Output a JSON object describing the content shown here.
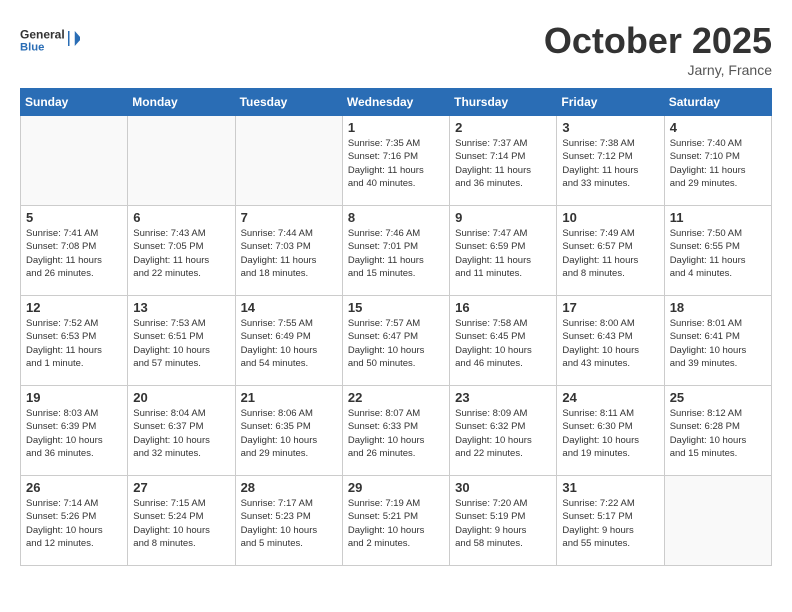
{
  "header": {
    "logo_line1": "General",
    "logo_line2": "Blue",
    "month_title": "October 2025",
    "location": "Jarny, France"
  },
  "days_of_week": [
    "Sunday",
    "Monday",
    "Tuesday",
    "Wednesday",
    "Thursday",
    "Friday",
    "Saturday"
  ],
  "weeks": [
    [
      {
        "num": "",
        "info": ""
      },
      {
        "num": "",
        "info": ""
      },
      {
        "num": "",
        "info": ""
      },
      {
        "num": "1",
        "info": "Sunrise: 7:35 AM\nSunset: 7:16 PM\nDaylight: 11 hours\nand 40 minutes."
      },
      {
        "num": "2",
        "info": "Sunrise: 7:37 AM\nSunset: 7:14 PM\nDaylight: 11 hours\nand 36 minutes."
      },
      {
        "num": "3",
        "info": "Sunrise: 7:38 AM\nSunset: 7:12 PM\nDaylight: 11 hours\nand 33 minutes."
      },
      {
        "num": "4",
        "info": "Sunrise: 7:40 AM\nSunset: 7:10 PM\nDaylight: 11 hours\nand 29 minutes."
      }
    ],
    [
      {
        "num": "5",
        "info": "Sunrise: 7:41 AM\nSunset: 7:08 PM\nDaylight: 11 hours\nand 26 minutes."
      },
      {
        "num": "6",
        "info": "Sunrise: 7:43 AM\nSunset: 7:05 PM\nDaylight: 11 hours\nand 22 minutes."
      },
      {
        "num": "7",
        "info": "Sunrise: 7:44 AM\nSunset: 7:03 PM\nDaylight: 11 hours\nand 18 minutes."
      },
      {
        "num": "8",
        "info": "Sunrise: 7:46 AM\nSunset: 7:01 PM\nDaylight: 11 hours\nand 15 minutes."
      },
      {
        "num": "9",
        "info": "Sunrise: 7:47 AM\nSunset: 6:59 PM\nDaylight: 11 hours\nand 11 minutes."
      },
      {
        "num": "10",
        "info": "Sunrise: 7:49 AM\nSunset: 6:57 PM\nDaylight: 11 hours\nand 8 minutes."
      },
      {
        "num": "11",
        "info": "Sunrise: 7:50 AM\nSunset: 6:55 PM\nDaylight: 11 hours\nand 4 minutes."
      }
    ],
    [
      {
        "num": "12",
        "info": "Sunrise: 7:52 AM\nSunset: 6:53 PM\nDaylight: 11 hours\nand 1 minute."
      },
      {
        "num": "13",
        "info": "Sunrise: 7:53 AM\nSunset: 6:51 PM\nDaylight: 10 hours\nand 57 minutes."
      },
      {
        "num": "14",
        "info": "Sunrise: 7:55 AM\nSunset: 6:49 PM\nDaylight: 10 hours\nand 54 minutes."
      },
      {
        "num": "15",
        "info": "Sunrise: 7:57 AM\nSunset: 6:47 PM\nDaylight: 10 hours\nand 50 minutes."
      },
      {
        "num": "16",
        "info": "Sunrise: 7:58 AM\nSunset: 6:45 PM\nDaylight: 10 hours\nand 46 minutes."
      },
      {
        "num": "17",
        "info": "Sunrise: 8:00 AM\nSunset: 6:43 PM\nDaylight: 10 hours\nand 43 minutes."
      },
      {
        "num": "18",
        "info": "Sunrise: 8:01 AM\nSunset: 6:41 PM\nDaylight: 10 hours\nand 39 minutes."
      }
    ],
    [
      {
        "num": "19",
        "info": "Sunrise: 8:03 AM\nSunset: 6:39 PM\nDaylight: 10 hours\nand 36 minutes."
      },
      {
        "num": "20",
        "info": "Sunrise: 8:04 AM\nSunset: 6:37 PM\nDaylight: 10 hours\nand 32 minutes."
      },
      {
        "num": "21",
        "info": "Sunrise: 8:06 AM\nSunset: 6:35 PM\nDaylight: 10 hours\nand 29 minutes."
      },
      {
        "num": "22",
        "info": "Sunrise: 8:07 AM\nSunset: 6:33 PM\nDaylight: 10 hours\nand 26 minutes."
      },
      {
        "num": "23",
        "info": "Sunrise: 8:09 AM\nSunset: 6:32 PM\nDaylight: 10 hours\nand 22 minutes."
      },
      {
        "num": "24",
        "info": "Sunrise: 8:11 AM\nSunset: 6:30 PM\nDaylight: 10 hours\nand 19 minutes."
      },
      {
        "num": "25",
        "info": "Sunrise: 8:12 AM\nSunset: 6:28 PM\nDaylight: 10 hours\nand 15 minutes."
      }
    ],
    [
      {
        "num": "26",
        "info": "Sunrise: 7:14 AM\nSunset: 5:26 PM\nDaylight: 10 hours\nand 12 minutes."
      },
      {
        "num": "27",
        "info": "Sunrise: 7:15 AM\nSunset: 5:24 PM\nDaylight: 10 hours\nand 8 minutes."
      },
      {
        "num": "28",
        "info": "Sunrise: 7:17 AM\nSunset: 5:23 PM\nDaylight: 10 hours\nand 5 minutes."
      },
      {
        "num": "29",
        "info": "Sunrise: 7:19 AM\nSunset: 5:21 PM\nDaylight: 10 hours\nand 2 minutes."
      },
      {
        "num": "30",
        "info": "Sunrise: 7:20 AM\nSunset: 5:19 PM\nDaylight: 9 hours\nand 58 minutes."
      },
      {
        "num": "31",
        "info": "Sunrise: 7:22 AM\nSunset: 5:17 PM\nDaylight: 9 hours\nand 55 minutes."
      },
      {
        "num": "",
        "info": ""
      }
    ]
  ]
}
